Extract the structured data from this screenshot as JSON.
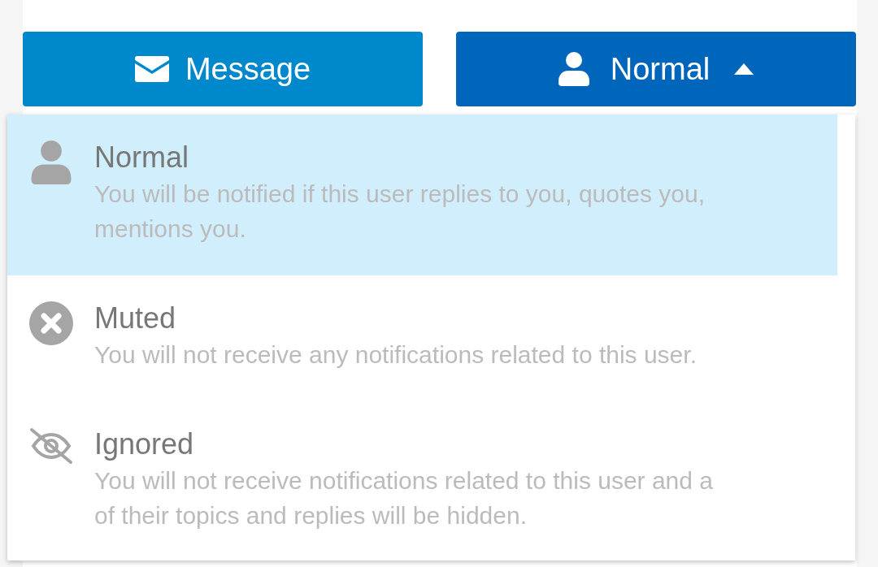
{
  "buttons": [
    {
      "kind": "message",
      "label": "Message"
    },
    {
      "kind": "level",
      "label": "Normal",
      "expanded": true
    }
  ],
  "menu": [
    {
      "kind": "normal",
      "title": "Normal",
      "selected": true,
      "description_lines": [
        "You will be notified if this user replies to you, quotes you,",
        "mentions you."
      ]
    },
    {
      "kind": "muted",
      "title": "Muted",
      "selected": false,
      "description_lines": [
        "You will not receive any notifications related to this user."
      ]
    },
    {
      "kind": "ignored",
      "title": "Ignored",
      "selected": false,
      "description_lines": [
        "You will not receive notifications related to this user and a",
        "of their topics and replies will be hidden."
      ]
    }
  ]
}
